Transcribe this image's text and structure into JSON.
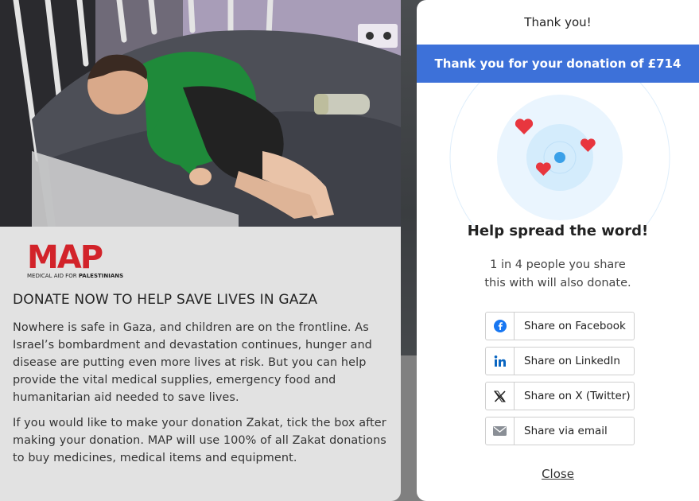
{
  "page": {
    "logo": {
      "letters": "MAP",
      "tagline_light": "MEDICAL AID FOR ",
      "tagline_bold": "PALESTINIANS",
      "color": "#d2232a"
    },
    "headline": "DONATE NOW TO HELP SAVE LIVES IN GAZA",
    "paragraphs": [
      "Nowhere is safe in Gaza, and children are on the frontline. As Israel’s bombardment and devastation continues, hunger and disease are putting even more lives at risk. But you can help provide the vital medical supplies, emergency food and humanitarian aid needed to save lives.",
      "If you would like to make your donation Zakat, tick the box after making your donation. MAP will use 100% of all Zakat donations to buy medicines, medical items and equipment."
    ]
  },
  "modal": {
    "title": "Thank you!",
    "banner": "Thank you for your donation of £714",
    "banner_color": "#3d71d9",
    "heading": "Help spread the word!",
    "subtext_line1": "1 in 4 people you share",
    "subtext_line2": "this with will also donate.",
    "share": [
      {
        "label": "Share on Facebook",
        "icon": "facebook-icon"
      },
      {
        "label": "Share on LinkedIn",
        "icon": "linkedin-icon"
      },
      {
        "label": "Share on X (Twitter)",
        "icon": "x-twitter-icon"
      },
      {
        "label": "Share via email",
        "icon": "email-icon"
      }
    ],
    "close": "Close"
  }
}
